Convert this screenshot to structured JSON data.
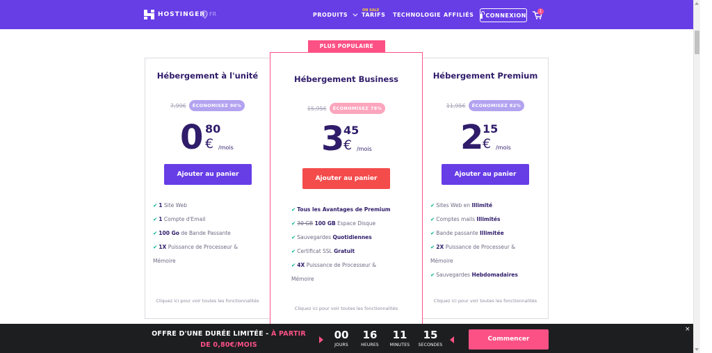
{
  "nav": {
    "brand": "HOSTINGER",
    "lang": "FR",
    "products": "PRODUITS",
    "sale_tag": "ON SALE",
    "pricing": "TARIFS",
    "technology": "TECHNOLOGIE",
    "affiliates": "AFFILIÉS",
    "login": "CONNEXION",
    "cart_count": "1"
  },
  "popular_badge": "PLUS POPULAIRE",
  "plans": [
    {
      "title": "Hébergement à l'unité",
      "old_price": "7,99€",
      "discount": "ÉCONOMISEZ 90%",
      "price_int": "0",
      "price_cents": "80",
      "currency": "€",
      "period": "/mois",
      "cta": "Ajouter au panier",
      "features": [
        {
          "strong": "1",
          "text": " Site Web"
        },
        {
          "strong": "1",
          "text": " Compte d'Email"
        },
        {
          "strong": "100 Go",
          "text": " de Bande Passante"
        },
        {
          "strong": "1X",
          "text": " Puissance de Processeur &"
        },
        {
          "strong": "",
          "text": "Mémoire"
        }
      ],
      "more": "Cliquez ici pour voir toutes les fonctionnalités"
    },
    {
      "title": "Hébergement Business",
      "old_price": "15,95€",
      "discount": "ÉCONOMISEZ 78%",
      "price_int": "3",
      "price_cents": "45",
      "currency": "€",
      "period": "/mois",
      "cta": "Ajouter au panier",
      "features": [
        {
          "strong": "Tous les Avantages de Premium",
          "text": ""
        },
        {
          "strike": "30 GB",
          "strong": "100 GB",
          "text": " Espace Disque"
        },
        {
          "pre": "Sauvegardes ",
          "strong": "Quotidiennes",
          "text": ""
        },
        {
          "pre": "Certificat SSL ",
          "strong": "Gratuit",
          "text": ""
        },
        {
          "strong": "4X",
          "text": " Puissance de Processeur &"
        },
        {
          "strong": "",
          "text": "Mémoire"
        }
      ],
      "more": "Cliquez ici pour voir toutes les fonctionnalités"
    },
    {
      "title": "Hébergement Premium",
      "old_price": "11,95€",
      "discount": "ÉCONOMISEZ 82%",
      "price_int": "2",
      "price_cents": "15",
      "currency": "€",
      "period": "/mois",
      "cta": "Ajouter au panier",
      "features": [
        {
          "pre": "Sites Web en ",
          "strong": "Illimité",
          "text": ""
        },
        {
          "pre": "Comptes mails ",
          "strong": "Illimités",
          "text": ""
        },
        {
          "pre": "Bande passante ",
          "strong": "Illimitée",
          "text": ""
        },
        {
          "strong": "2X",
          "text": " Puissance de Processeur &"
        },
        {
          "strong": "",
          "text": "Mémoire"
        },
        {
          "pre": "Sauvegardes ",
          "strong": "Hebdomadaires",
          "text": ""
        }
      ],
      "more": "Cliquez ici pour voir toutes les fonctionnalités"
    }
  ],
  "offer": {
    "line1": "OFFRE D'UNE DURÉE LIMITÉE - ",
    "line1_hl": "À PARTIR",
    "line2": "DE 0,80€/MOIS",
    "timer": [
      {
        "value": "00",
        "label": "JOURS"
      },
      {
        "value": "16",
        "label": "HEURES"
      },
      {
        "value": "11",
        "label": "MINUTES"
      },
      {
        "value": "15",
        "label": "SECONDES"
      }
    ],
    "cta": "Commencer",
    "close": "×"
  },
  "colors": {
    "brand": "#673de6",
    "accent": "#fc5185",
    "check": "#00b090"
  }
}
